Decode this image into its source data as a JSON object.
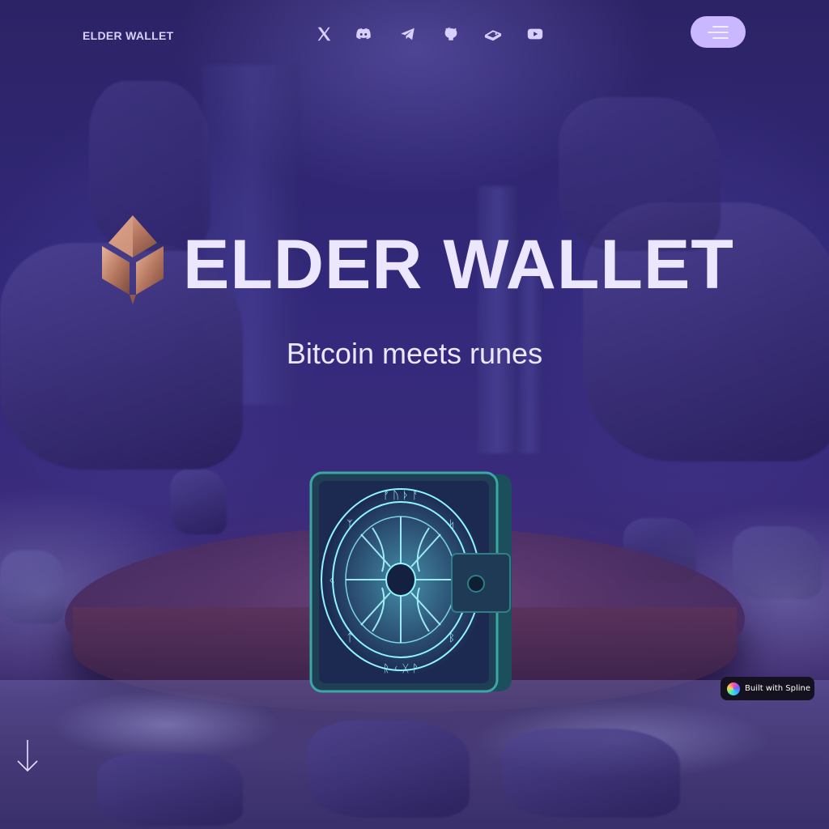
{
  "header": {
    "brand": "ELDER WALLET",
    "social_icons": [
      "x-icon",
      "discord-icon",
      "telegram-icon",
      "github-icon",
      "gitbook-icon",
      "youtube-icon"
    ],
    "menu_button_icon": "hamburger-menu-icon"
  },
  "hero": {
    "title": "ELDER WALLET",
    "subtitle": "Bitcoin meets runes"
  },
  "badge": {
    "label": "Built with Spline"
  },
  "colors": {
    "accent": "#c9b8ff",
    "title": "#ece6ff",
    "background": "#2c2366",
    "rune_glow": "#6ef2ff"
  }
}
